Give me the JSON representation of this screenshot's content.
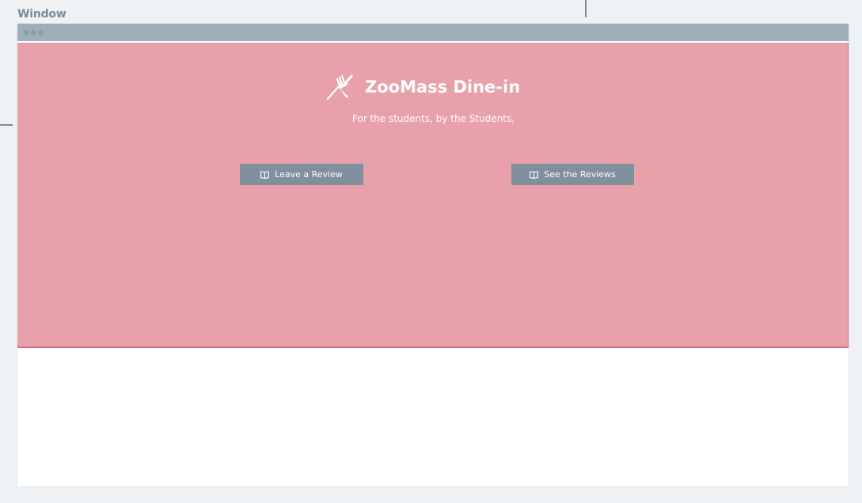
{
  "window": {
    "label": "Window"
  },
  "app": {
    "title": "ZooMass Dine-in",
    "tagline": "For the students, by the Students,",
    "icon": "fork-knife-icon"
  },
  "actions": {
    "leave_review_label": "Leave a Review",
    "leave_review_icon": "book-icon",
    "see_reviews_label": "See the Reviews",
    "see_reviews_icon": "book-icon"
  },
  "colors": {
    "page_background": "#eff2f5",
    "titlebar": "#9eafbb",
    "hero_background": "#e8a0aa",
    "hero_border": "#d9727f",
    "button_background": "#808f9c",
    "label_text": "#7c8b9a"
  }
}
